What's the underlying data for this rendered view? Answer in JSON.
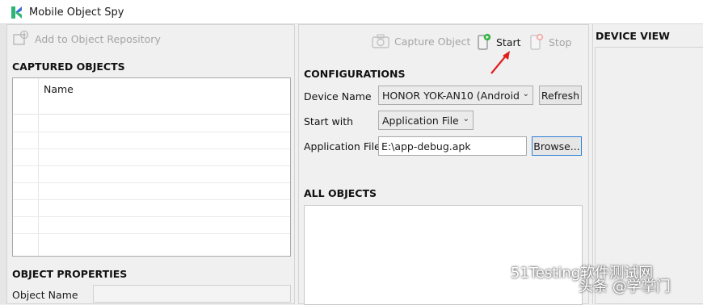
{
  "window": {
    "title": "Mobile Object Spy"
  },
  "left_panel": {
    "add_to_repo_label": "Add to Object Repository",
    "captured_objects_title": "CAPTURED OBJECTS",
    "table": {
      "columns": [
        "Name"
      ],
      "rows": []
    },
    "object_properties_title": "OBJECT PROPERTIES",
    "object_name_label": "Object Name",
    "object_name_value": ""
  },
  "toolbar": {
    "capture_label": "Capture Object",
    "start_label": "Start",
    "stop_label": "Stop"
  },
  "configurations": {
    "title": "CONFIGURATIONS",
    "device_name_label": "Device Name",
    "device_name_value": "HONOR YOK-AN10 (Android",
    "refresh_label": "Refresh",
    "start_with_label": "Start with",
    "start_with_value": "Application File",
    "application_file_label": "Application File",
    "application_file_value": "E:\\app-debug.apk",
    "browse_label": "Browse..."
  },
  "all_objects": {
    "title": "ALL OBJECTS"
  },
  "device_view": {
    "title": "DEVICE VIEW"
  },
  "watermark": {
    "line1": "51Testing软件测试网",
    "line2": "头条 @学掌门"
  },
  "colors": {
    "accent": "#2f7fd8",
    "app_icon_green": "#2bb673",
    "app_icon_blue": "#3d6fd6",
    "annotation_arrow": "#e02020"
  }
}
